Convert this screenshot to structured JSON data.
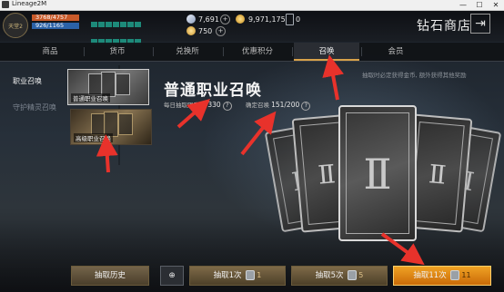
{
  "window": {
    "title": "Lineage2M",
    "minimize": "—",
    "maximize": "☐",
    "close": "✕"
  },
  "header": {
    "avatar_text": "天堂2",
    "hp": "3768/4757",
    "mp": "926/1165",
    "currencies": [
      {
        "icon": "diamond-icon",
        "value": "7,691",
        "color": "#a9b7d1"
      },
      {
        "icon": "gold-coin-icon",
        "value": "9,971,175",
        "color": "#d8a836"
      },
      {
        "icon": "token-icon",
        "value": "0",
        "color": "#8d949c"
      },
      {
        "icon": "gem-icon",
        "value": "750",
        "color": "#e0b23a"
      }
    ],
    "plus": "+",
    "shop_title": "钻石商店",
    "exit_icon": "⇥"
  },
  "tabs": [
    {
      "label": "商品",
      "active": false
    },
    {
      "label": "货币",
      "active": false
    },
    {
      "label": "兑换所",
      "active": false
    },
    {
      "label": "优惠积分",
      "active": false
    },
    {
      "label": "召唤",
      "active": true
    },
    {
      "label": "会员",
      "active": false
    }
  ],
  "sidebar": {
    "items": [
      {
        "label": "职业召唤",
        "active": true
      },
      {
        "label": "守护精灵召唤",
        "active": false
      }
    ]
  },
  "thumbnails": [
    {
      "label": "普通职业召唤",
      "selected": true
    },
    {
      "label": "高级职业召唤",
      "selected": false
    }
  ],
  "main": {
    "title": "普通职业召唤",
    "daily_label": "每日抽取限度",
    "daily_value": "0/330",
    "guarantee_label": "确定召唤",
    "guarantee_value": "151/200",
    "help": "?",
    "tip": "抽取时必定获得金币, 额外获得其他奖励"
  },
  "buttons": {
    "history": "抽取历史",
    "zoom_icon": "⊕",
    "draw1": "抽取1次",
    "draw1_cost": "1",
    "draw5": "抽取5次",
    "draw5_cost": "5",
    "draw11": "抽取11次",
    "draw11_cost": "11"
  },
  "colors": {
    "accent": "#d8a24a",
    "arrow": "#e8322b",
    "draw11": "#e38a16"
  }
}
